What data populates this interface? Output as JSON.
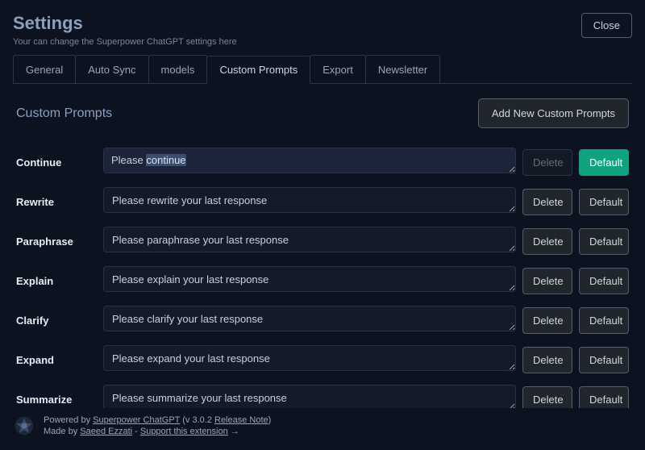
{
  "header": {
    "title": "Settings",
    "subtitle": "Your can change the Superpower ChatGPT settings here",
    "close_label": "Close"
  },
  "tabs": [
    {
      "label": "General",
      "active": false
    },
    {
      "label": "Auto Sync",
      "active": false
    },
    {
      "label": "models",
      "active": false
    },
    {
      "label": "Custom Prompts",
      "active": true
    },
    {
      "label": "Export",
      "active": false
    },
    {
      "label": "Newsletter",
      "active": false
    }
  ],
  "section": {
    "title": "Custom Prompts",
    "add_label": "Add New Custom Prompts"
  },
  "buttons": {
    "delete": "Delete",
    "default": "Default"
  },
  "prompts": [
    {
      "name": "Continue",
      "value": "Please continue",
      "delete_disabled": true,
      "default_primary": true,
      "highlighted": true,
      "sel_prefix": "Please ",
      "sel_text": "continue"
    },
    {
      "name": "Rewrite",
      "value": "Please rewrite your last response",
      "delete_disabled": false,
      "default_primary": false
    },
    {
      "name": "Paraphrase",
      "value": "Please paraphrase your last response",
      "delete_disabled": false,
      "default_primary": false
    },
    {
      "name": "Explain",
      "value": "Please explain your last response",
      "delete_disabled": false,
      "default_primary": false
    },
    {
      "name": "Clarify",
      "value": "Please clarify your last response",
      "delete_disabled": false,
      "default_primary": false
    },
    {
      "name": "Expand",
      "value": "Please expand your last response",
      "delete_disabled": false,
      "default_primary": false
    },
    {
      "name": "Summarize",
      "value": "Please summarize your last response",
      "delete_disabled": false,
      "default_primary": false
    }
  ],
  "footer": {
    "powered_prefix": "Powered by ",
    "powered_link": "Superpower ChatGPT",
    "version_prefix": " (v ",
    "version": "3.0.2",
    "release_note": "Release Note",
    "version_suffix": ")",
    "made_prefix": "Made by ",
    "made_link": "Saeed Ezzati",
    "separator": " -  ",
    "support_link": "Support this extension",
    "arrow": " →"
  }
}
